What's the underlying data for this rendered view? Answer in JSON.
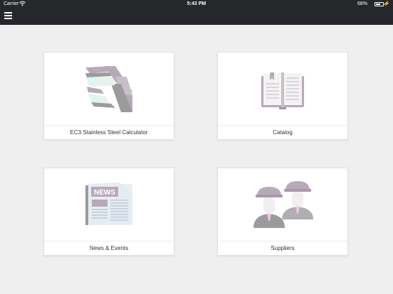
{
  "status_bar": {
    "carrier": "Carrier",
    "time": "5:43 PM",
    "battery": "68%",
    "battery_level": 0.68
  },
  "toolbar": {
    "menu_icon": "hamburger-menu-icon"
  },
  "tiles": [
    {
      "label": "EC3 Stainless Steel Calculator",
      "icon": "steel-beams-icon"
    },
    {
      "label": "Catalog",
      "icon": "open-book-icon"
    },
    {
      "label": "News & Events",
      "icon": "newspaper-icon",
      "headline": "NEWS"
    },
    {
      "label": "Suppliers",
      "icon": "workers-hardhat-icon"
    }
  ],
  "colors": {
    "header_bg": "#26272b",
    "page_bg": "#efeff0",
    "icon_mauve": "#b8a9b8",
    "icon_grey": "#9c9a9c",
    "icon_mint": "#e3f3ee",
    "icon_pink": "#f1c3e0"
  }
}
